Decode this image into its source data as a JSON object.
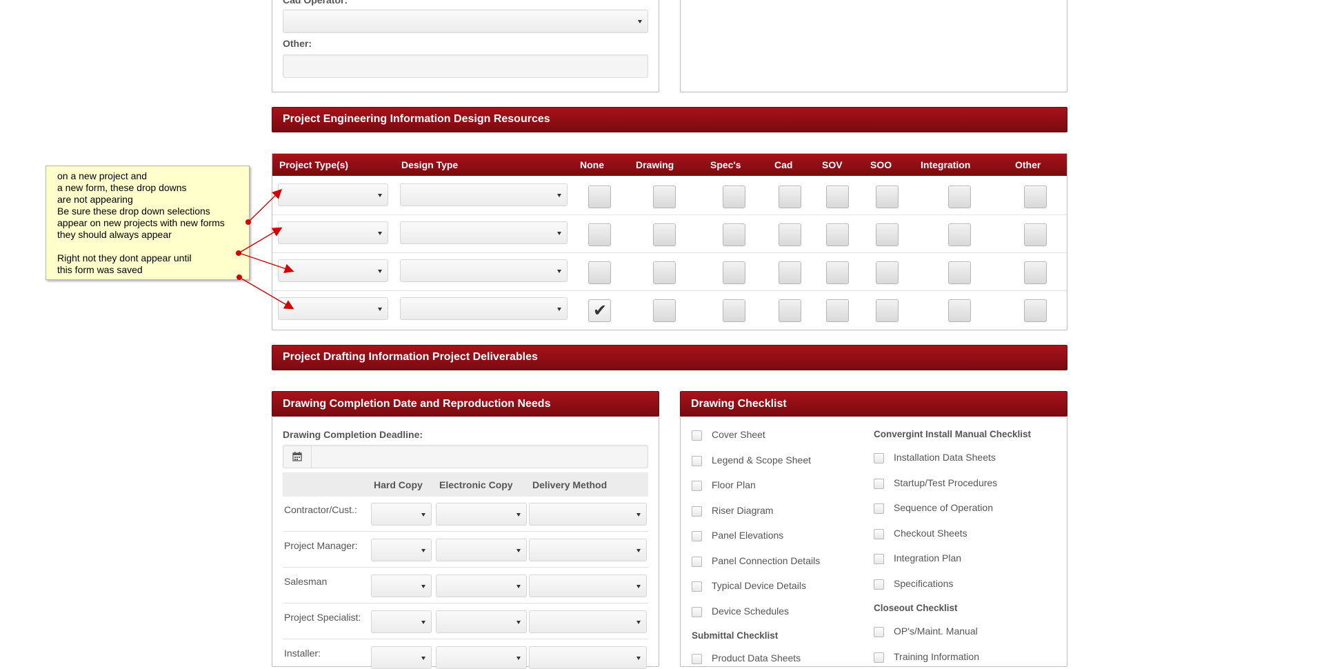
{
  "top_section": {
    "cad_operator_label": "Cad Operator:",
    "other_label": "Other:"
  },
  "engineering": {
    "title": "Project Engineering Information Design Resources",
    "columns": [
      "Project Type(s)",
      "Design Type",
      "None",
      "Drawing",
      "Spec's",
      "Cad",
      "SOV",
      "SOO",
      "Integration",
      "Other"
    ],
    "rows_checked": [
      [
        false,
        false,
        false,
        false,
        false,
        false,
        false,
        false
      ],
      [
        false,
        false,
        false,
        false,
        false,
        false,
        false,
        false
      ],
      [
        false,
        false,
        false,
        false,
        false,
        false,
        false,
        false
      ],
      [
        true,
        false,
        false,
        false,
        false,
        false,
        false,
        false
      ]
    ]
  },
  "drafting": {
    "title": "Project Drafting Information Project Deliverables"
  },
  "completion": {
    "title": "Drawing Completion Date and Reproduction Needs",
    "deadline_label": "Drawing Completion Deadline:",
    "headers": {
      "hard_copy": "Hard Copy",
      "electronic_copy": "Electronic Copy",
      "delivery_method": "Delivery Method"
    },
    "rows": [
      "Contractor/Cust.:",
      "Project Manager:",
      "Salesman",
      "Project Specialist:",
      "Installer:"
    ]
  },
  "checklist": {
    "title": "Drawing Checklist",
    "left_items": [
      "Cover Sheet",
      "Legend & Scope Sheet",
      "Floor Plan",
      "Riser Diagram",
      "Panel Elevations",
      "Panel Connection Details",
      "Typical Device Details",
      "Device Schedules"
    ],
    "submittal_title": "Submittal Checklist",
    "submittal_items": [
      "Product Data Sheets"
    ],
    "install_title": "Convergint Install Manual Checklist",
    "install_items": [
      "Installation Data Sheets",
      "Startup/Test Procedures",
      "Sequence of Operation",
      "Checkout Sheets",
      "Integration Plan",
      "Specifications"
    ],
    "closeout_title": "Closeout Checklist",
    "closeout_items": [
      "OP's/Maint. Manual",
      "Training Information"
    ]
  },
  "annotation": {
    "lines": [
      "on a new project and",
      "a new form, these drop downs",
      "are not appearing",
      "Be sure these drop down selections",
      "appear on new projects with new forms",
      "they should always appear",
      "",
      "Right not they dont appear until",
      "this form was saved"
    ],
    "arrow_color": "#d40000"
  },
  "icons": {
    "calendar": "calendar-icon",
    "check": "checkmark-icon"
  }
}
